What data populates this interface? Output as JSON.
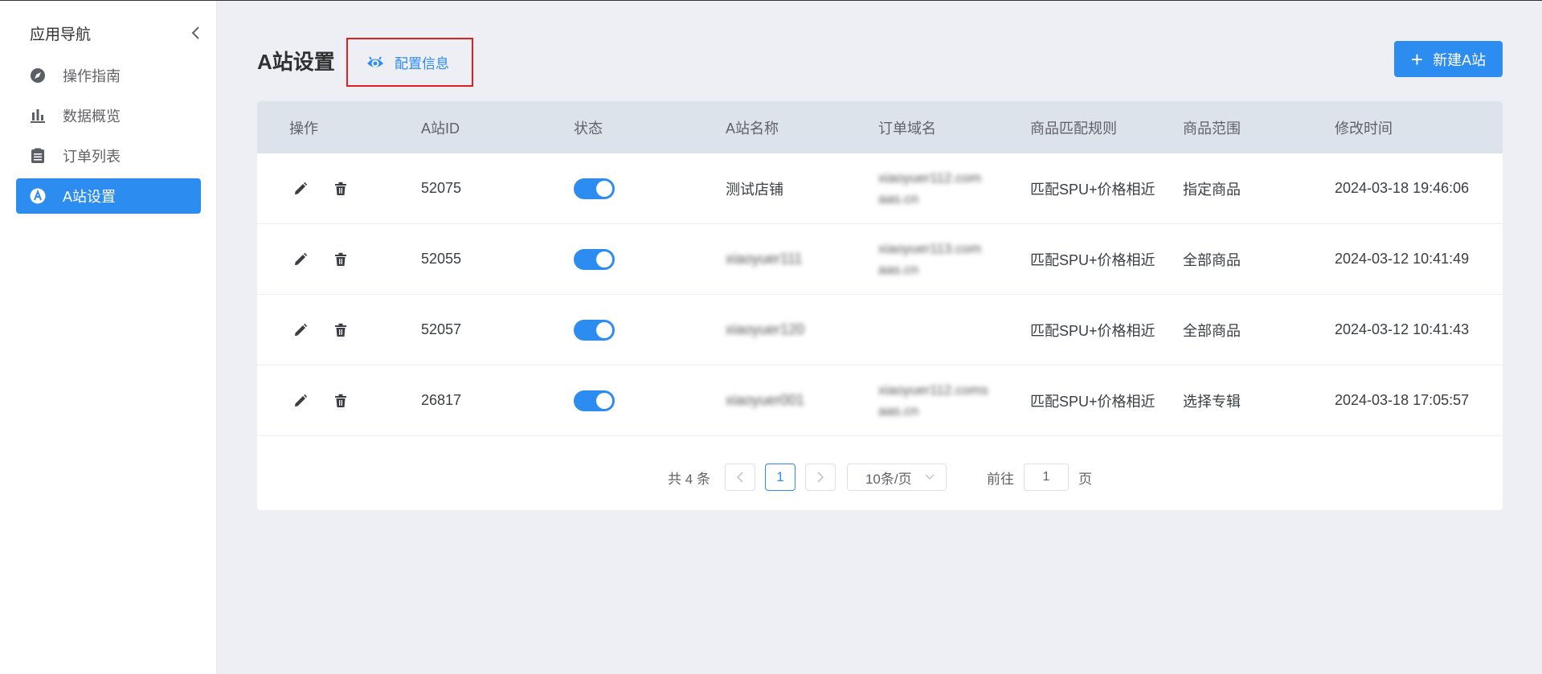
{
  "sidebar": {
    "title": "应用导航",
    "items": [
      {
        "label": "操作指南",
        "icon": "compass-icon"
      },
      {
        "label": "数据概览",
        "icon": "bar-chart-icon"
      },
      {
        "label": "订单列表",
        "icon": "clipboard-icon"
      },
      {
        "label": "A站设置",
        "icon": "a-circle-icon",
        "active": true
      }
    ]
  },
  "header": {
    "title": "A站设置",
    "config_link": "配置信息",
    "new_button": "新建A站"
  },
  "table": {
    "columns": [
      "操作",
      "A站ID",
      "状态",
      "A站名称",
      "订单域名",
      "商品匹配规则",
      "商品范围",
      "修改时间"
    ],
    "rows": [
      {
        "id": "52075",
        "status": true,
        "name": "测试店铺",
        "domain": "xiaoyuer112.com\naas.cn",
        "rule": "匹配SPU+价格相近",
        "range": "指定商品",
        "time": "2024-03-18 19:46:06"
      },
      {
        "id": "52055",
        "status": true,
        "name": "xiaoyuer111",
        "domain": "xiaoyuer113.com\naas.cn",
        "rule": "匹配SPU+价格相近",
        "range": "全部商品",
        "time": "2024-03-12 10:41:49"
      },
      {
        "id": "52057",
        "status": true,
        "name": "xiaoyuer120",
        "domain": "",
        "rule": "匹配SPU+价格相近",
        "range": "全部商品",
        "time": "2024-03-12 10:41:43"
      },
      {
        "id": "26817",
        "status": true,
        "name": "xiaoyuer001",
        "domain": "xiaoyuer112.coms\naas.cn",
        "rule": "匹配SPU+价格相近",
        "range": "选择专辑",
        "time": "2024-03-18 17:05:57"
      }
    ]
  },
  "pagination": {
    "total": "共 4 条",
    "current_page": "1",
    "page_size": "10条/页",
    "jump_label": "前往",
    "jump_value": "1",
    "jump_unit": "页"
  },
  "colors": {
    "accent": "#2d8cf0",
    "highlight_border": "#e02020",
    "table_header_bg": "#dde3eb",
    "page_bg": "#edeff4"
  }
}
